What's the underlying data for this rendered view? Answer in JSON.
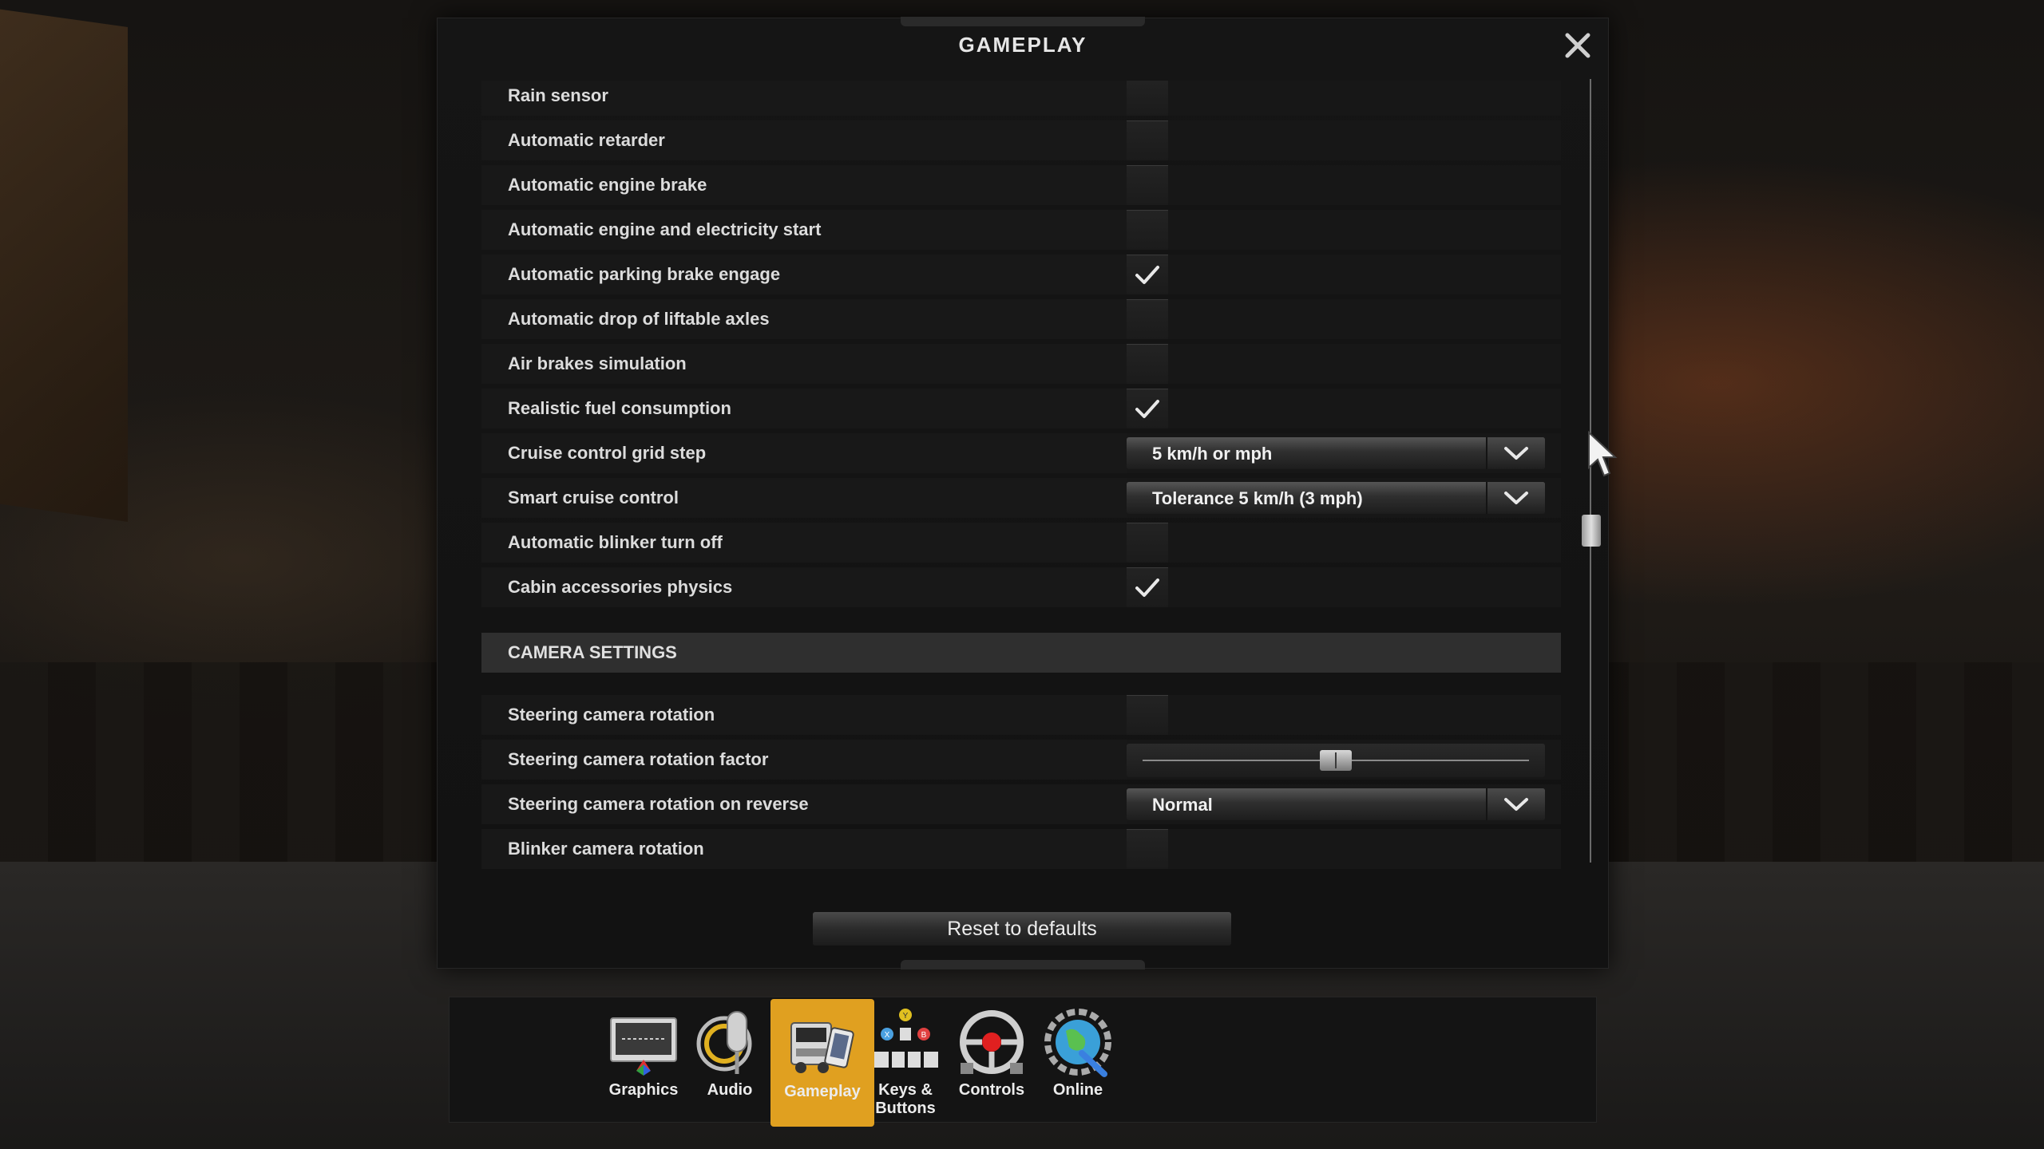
{
  "window": {
    "title": "GAMEPLAY",
    "close_icon": "close-icon"
  },
  "settings": [
    {
      "label": "Rain sensor",
      "control": "checkbox",
      "checked": false
    },
    {
      "label": "Automatic retarder",
      "control": "checkbox",
      "checked": false
    },
    {
      "label": "Automatic engine brake",
      "control": "checkbox",
      "checked": false
    },
    {
      "label": "Automatic engine and electricity start",
      "control": "checkbox",
      "checked": false
    },
    {
      "label": "Automatic parking brake engage",
      "control": "checkbox",
      "checked": true
    },
    {
      "label": "Automatic drop of liftable axles",
      "control": "checkbox",
      "checked": false
    },
    {
      "label": "Air brakes simulation",
      "control": "checkbox",
      "checked": false
    },
    {
      "label": "Realistic fuel consumption",
      "control": "checkbox",
      "checked": true
    },
    {
      "label": "Cruise control grid step",
      "control": "dropdown",
      "value": "5 km/h or mph"
    },
    {
      "label": "Smart cruise control",
      "control": "dropdown",
      "value": "Tolerance 5 km/h (3 mph)"
    },
    {
      "label": "Automatic blinker turn off",
      "control": "checkbox",
      "checked": false
    },
    {
      "label": "Cabin accessories physics",
      "control": "checkbox",
      "checked": true
    }
  ],
  "camera_section": {
    "title": "CAMERA SETTINGS",
    "items": [
      {
        "label": "Steering camera rotation",
        "control": "checkbox",
        "checked": false
      },
      {
        "label": "Steering camera rotation factor",
        "control": "slider",
        "value_fraction": 0.5
      },
      {
        "label": "Steering camera rotation on reverse",
        "control": "dropdown",
        "value": "Normal"
      },
      {
        "label": "Blinker camera rotation",
        "control": "checkbox",
        "checked": false
      }
    ]
  },
  "scroll": {
    "position_fraction": 0.58
  },
  "reset_button": {
    "label": "Reset to defaults"
  },
  "nav": [
    {
      "label": "Graphics",
      "icon": "monitor-icon",
      "active": false
    },
    {
      "label": "Audio",
      "icon": "microphone-icon",
      "active": false
    },
    {
      "label": "Gameplay",
      "icon": "truck-phone-icon",
      "active": true
    },
    {
      "label": "Keys &\nButtons",
      "icon": "keys-buttons-icon",
      "active": false
    },
    {
      "label": "Controls",
      "icon": "steering-wheel-icon",
      "active": false
    },
    {
      "label": "Online",
      "icon": "globe-gear-icon",
      "active": false
    }
  ],
  "colors": {
    "accent": "#e0a020",
    "panel_bg": "#131313",
    "text": "#dcdcdc"
  }
}
